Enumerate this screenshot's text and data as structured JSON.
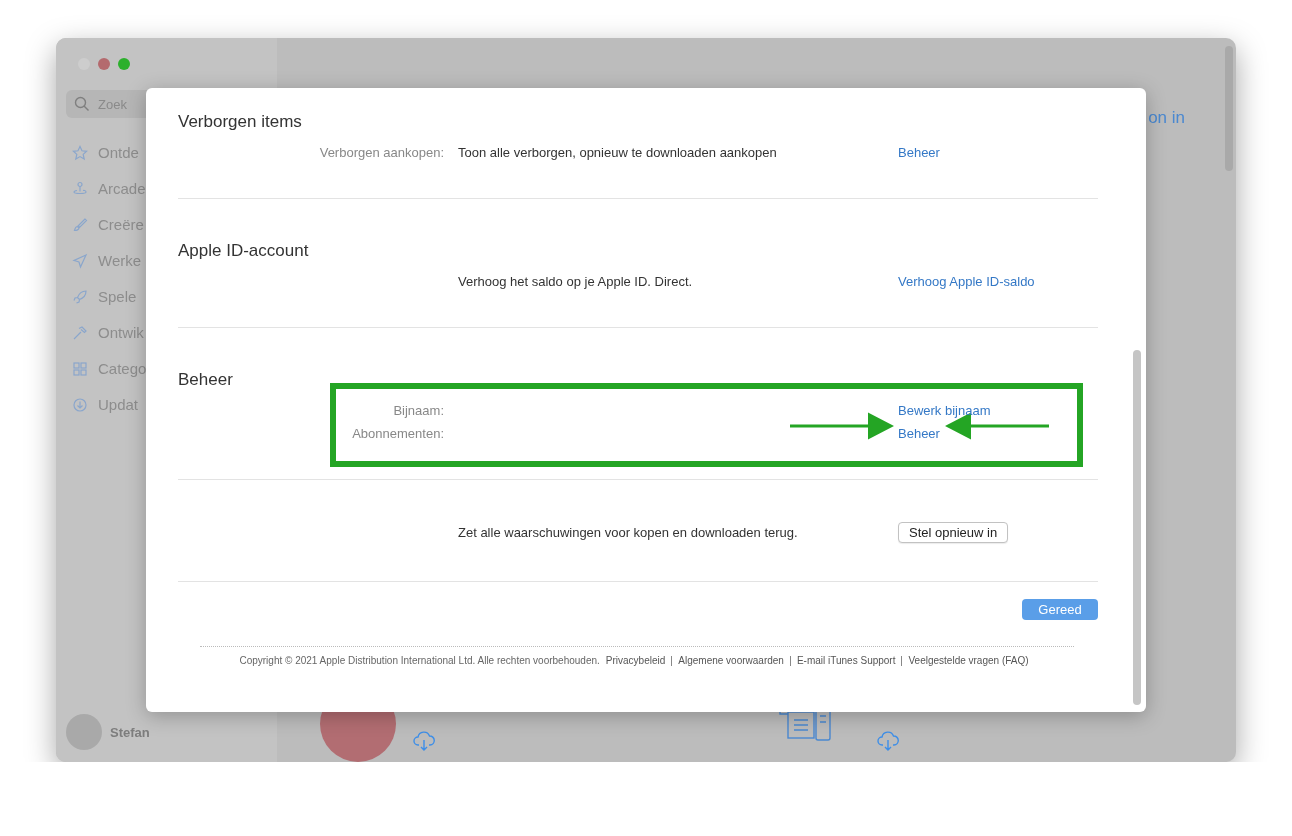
{
  "sidebar": {
    "search": {
      "placeholder": "Zoek"
    },
    "items": [
      {
        "label": "Ontde"
      },
      {
        "label": "Arcade"
      },
      {
        "label": "Creëre"
      },
      {
        "label": "Werke"
      },
      {
        "label": "Spele"
      },
      {
        "label": "Ontwik"
      },
      {
        "label": "Catego"
      },
      {
        "label": "Updat"
      }
    ],
    "user": {
      "name": "Stefan"
    }
  },
  "background": {
    "link": "on in"
  },
  "dialog": {
    "sections": [
      {
        "title": "Verborgen items",
        "highlighted": false,
        "rows": [
          {
            "label": "Verborgen aankopen:",
            "value": "Toon alle verborgen, opnieuw te downloaden aankopen",
            "action": {
              "kind": "link",
              "text": "Beheer"
            },
            "pointed": false
          }
        ]
      },
      {
        "title": "Apple ID-account",
        "highlighted": false,
        "rows": [
          {
            "value": "Verhoog het saldo op je Apple ID. Direct.",
            "action": {
              "kind": "link",
              "text": "Verhoog Apple ID-saldo"
            },
            "pointed": false
          }
        ]
      },
      {
        "title": "Beheer",
        "highlighted": true,
        "rows": [
          {
            "label": "Bijnaam:",
            "action": {
              "kind": "link",
              "text": "Bewerk bijnaam"
            },
            "pointed": false
          },
          {
            "label": "Abonnementen:",
            "action": {
              "kind": "link",
              "text": "Beheer"
            },
            "pointed": true
          }
        ]
      },
      {
        "highlighted": false,
        "rows": [
          {
            "value": "Zet alle waarschuwingen voor kopen en downloaden terug.",
            "action": {
              "kind": "button",
              "text": "Stel opnieuw in"
            },
            "pointed": false
          }
        ]
      }
    ],
    "done_button": "Gereed",
    "footer": {
      "copyright": "Copyright © 2021 Apple Distribution International Ltd. Alle rechten voorbehouden.",
      "links": [
        "Privacybeleid",
        "Algemene voorwaarden",
        "E-mail iTunes Support",
        "Veelgestelde vragen (FAQ)"
      ]
    }
  }
}
